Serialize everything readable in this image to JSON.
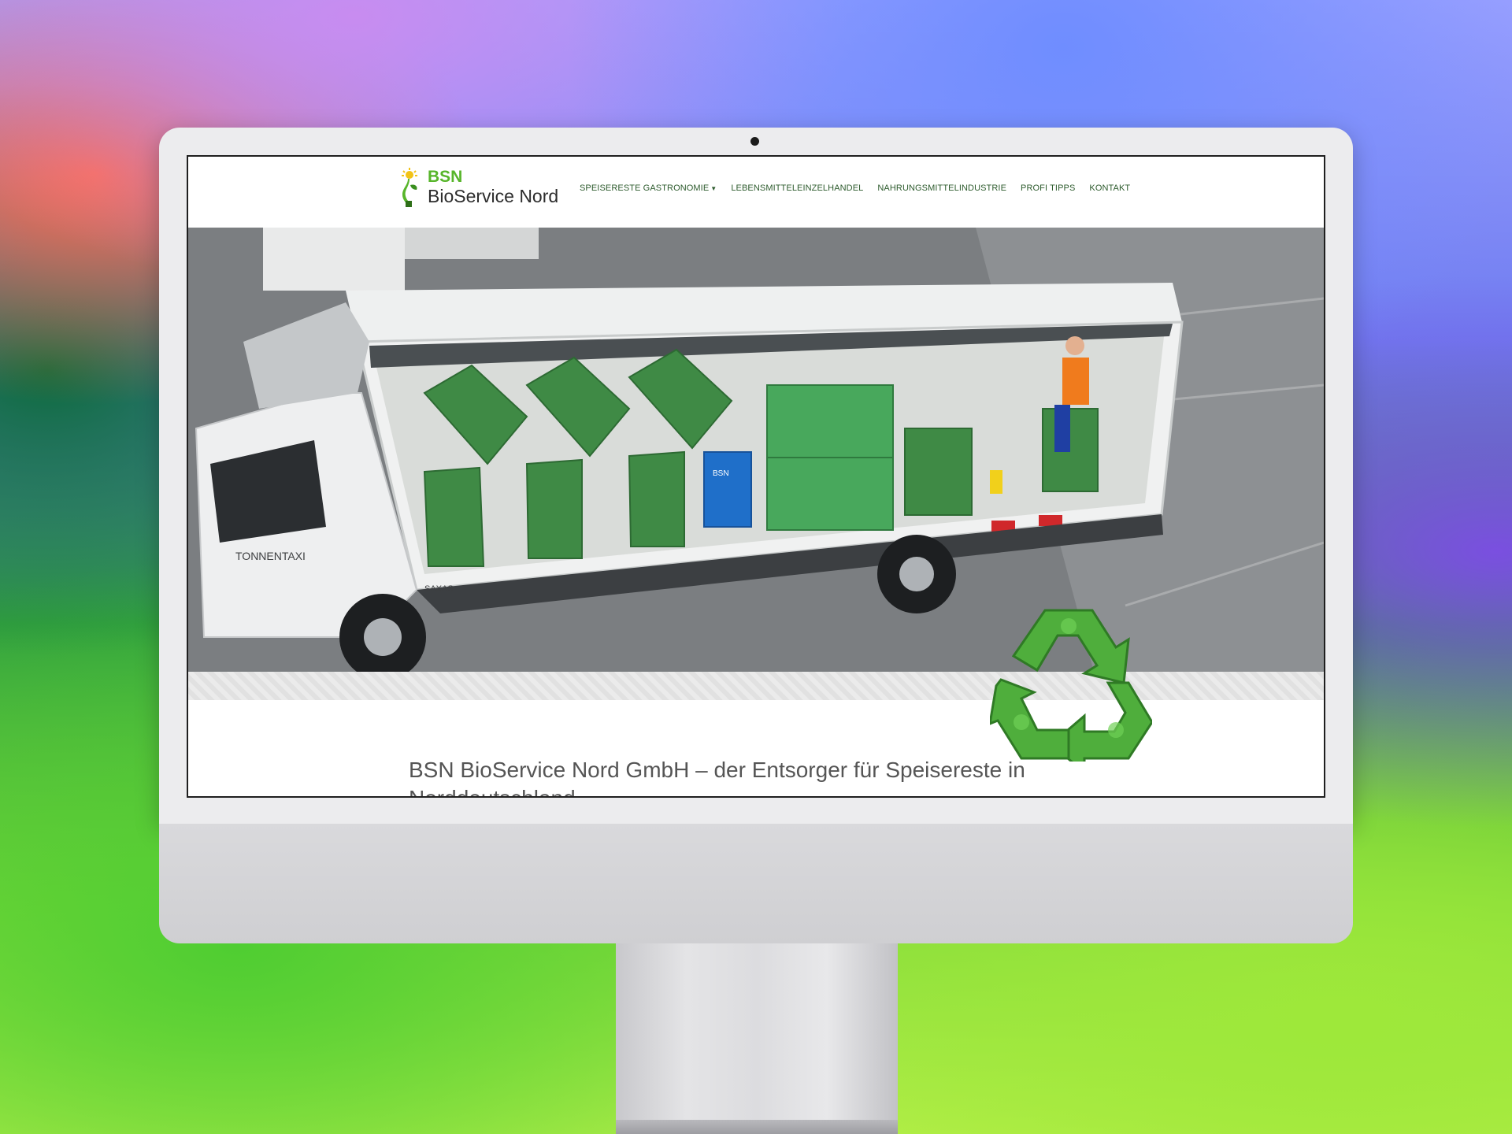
{
  "logo": {
    "short": "BSN",
    "name": "BioService Nord"
  },
  "nav": {
    "items": [
      {
        "label": "SPEISERESTE GASTRONOMIE",
        "has_dropdown": true
      },
      {
        "label": "LEBENSMITTELEINZELHANDEL"
      },
      {
        "label": "NAHRUNGSMITTELINDUSTRIE"
      },
      {
        "label": "PROFI TIPPS"
      },
      {
        "label": "KONTAKT"
      }
    ]
  },
  "hero": {
    "truck_cab_text": "TONNENTAXI",
    "truck_brand": "SAXAS",
    "crate_label": "BSN"
  },
  "content": {
    "title": "BSN BioService Nord GmbH – der Entsorger für Speisereste in Norddeutschland"
  },
  "colors": {
    "brand_green": "#57b52a",
    "nav_text": "#2d5b2d",
    "bin_green": "#3f8a45"
  }
}
